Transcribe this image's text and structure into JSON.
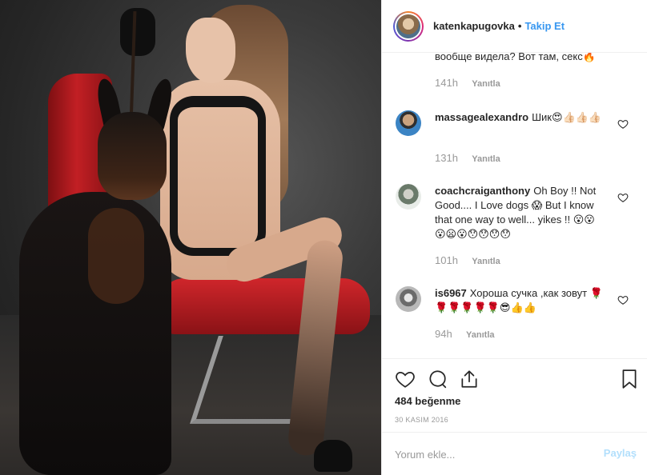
{
  "post": {
    "photo_alt": "",
    "header": {
      "username": "katenkapugovka",
      "separator": "•",
      "follow_label": "Takip Et"
    },
    "comments": [
      {
        "username": "",
        "text": "вообще видела? Вот там, секс🔥",
        "time": "141h",
        "reply_label": "Yanıtla",
        "has_heart": false
      },
      {
        "username": "massagealexandro",
        "text": "Шик😍👍🏻👍🏻👍🏻",
        "time": "131h",
        "reply_label": "Yanıtla",
        "has_heart": true
      },
      {
        "username": "coachcraiganthony",
        "text": "Oh Boy !! Not Good.... I Love dogs 😱 But I know that one way to well... yikes !! 😮😮😮😦😮😯😯😯😯",
        "time": "101h",
        "reply_label": "Yanıtla",
        "has_heart": true
      },
      {
        "username": "is6967",
        "text": "Хороша сучка ,как зовут 🌹🌹🌹🌹🌹🌹😎👍👍",
        "time": "94h",
        "reply_label": "Yanıtla",
        "has_heart": true
      }
    ],
    "likes_text": "484 beğenme",
    "date_text": "30 KASIM 2016",
    "comment_placeholder": "Yorum ekle...",
    "post_button_label": "Paylaş",
    "icons": {
      "like": "heart-icon",
      "comment": "comment-icon",
      "share": "share-icon",
      "save": "bookmark-icon"
    },
    "colors": {
      "accent": "#3897f0",
      "muted": "#999999",
      "post_button_disabled": "#b2dffc",
      "chair": "#c21f24"
    }
  }
}
